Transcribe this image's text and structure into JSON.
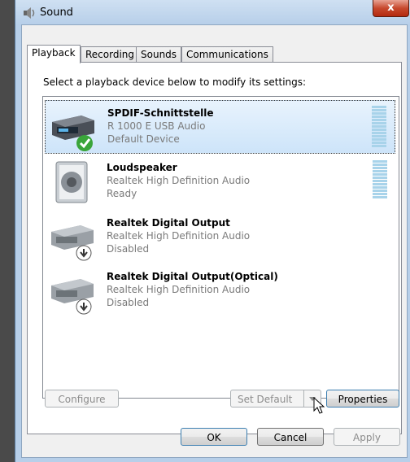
{
  "window": {
    "title": "Sound",
    "close_glyph": "x"
  },
  "tabs": [
    {
      "label": "Playback",
      "active": true
    },
    {
      "label": "Recording",
      "active": false
    },
    {
      "label": "Sounds",
      "active": false
    },
    {
      "label": "Communications",
      "active": false
    }
  ],
  "instruction": "Select a playback device below to modify its settings:",
  "devices": [
    {
      "name": "SPDIF-Schnittstelle",
      "line2": "R 1000 E  USB Audio",
      "line3": "Default Device",
      "icon": "digital-output-icon",
      "status_badge": "check-badge",
      "selected": true,
      "has_meter": true
    },
    {
      "name": "Loudspeaker",
      "line2": "Realtek High Definition Audio",
      "line3": "Ready",
      "icon": "speaker-icon",
      "status_badge": "",
      "selected": false,
      "has_meter": true
    },
    {
      "name": "Realtek Digital Output",
      "line2": "Realtek High Definition Audio",
      "line3": "Disabled",
      "icon": "digital-output-icon",
      "status_badge": "disabled-badge",
      "selected": false,
      "has_meter": false
    },
    {
      "name": "Realtek Digital Output(Optical)",
      "line2": "Realtek High Definition Audio",
      "line3": "Disabled",
      "icon": "digital-output-icon",
      "status_badge": "disabled-badge",
      "selected": false,
      "has_meter": false
    }
  ],
  "buttons": {
    "configure": "Configure",
    "set_default": "Set Default",
    "properties": "Properties",
    "ok": "OK",
    "cancel": "Cancel",
    "apply": "Apply"
  },
  "colors": {
    "selection": "#cde4f9",
    "meter": "#a8d3ea",
    "close": "#c7492e"
  }
}
